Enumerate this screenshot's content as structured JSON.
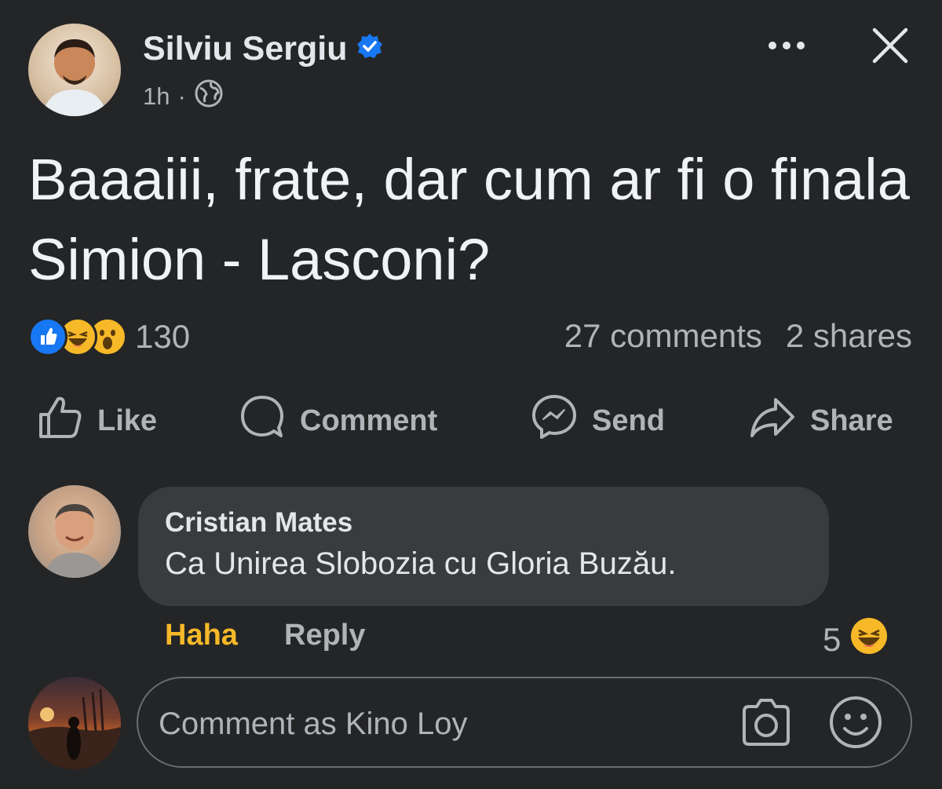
{
  "post": {
    "author": "Silviu Sergiu",
    "time": "1h",
    "separator": "·",
    "text": "Baaaiii, frate, dar cum ar fi o finala Simion - Lasconi?",
    "reactions_count": "130",
    "comments": "27 comments",
    "shares": "2 shares"
  },
  "actions": {
    "like": "Like",
    "comment": "Comment",
    "send": "Send",
    "share": "Share"
  },
  "comment": {
    "author": "Cristian Mates",
    "text": "Ca Unirea Slobozia cu Gloria Buzău.",
    "haha": "Haha",
    "reply": "Reply",
    "reaction_count": "5"
  },
  "composer": {
    "placeholder": "Comment as Kino Loy"
  },
  "icons": {
    "verified": "verified-badge-icon",
    "globe": "globe-icon",
    "more": "more-options-icon",
    "close": "close-icon",
    "like": "like-icon",
    "comment": "comment-icon",
    "send": "messenger-icon",
    "share": "share-icon",
    "camera": "camera-icon",
    "emoji": "emoji-icon"
  },
  "colors": {
    "background": "#242526",
    "bubble": "#3a3b3c",
    "text_primary": "#e4e6eb",
    "text_secondary": "#b0b3b8",
    "verified_blue": "#1877f2",
    "haha_yellow": "#f7b928"
  }
}
